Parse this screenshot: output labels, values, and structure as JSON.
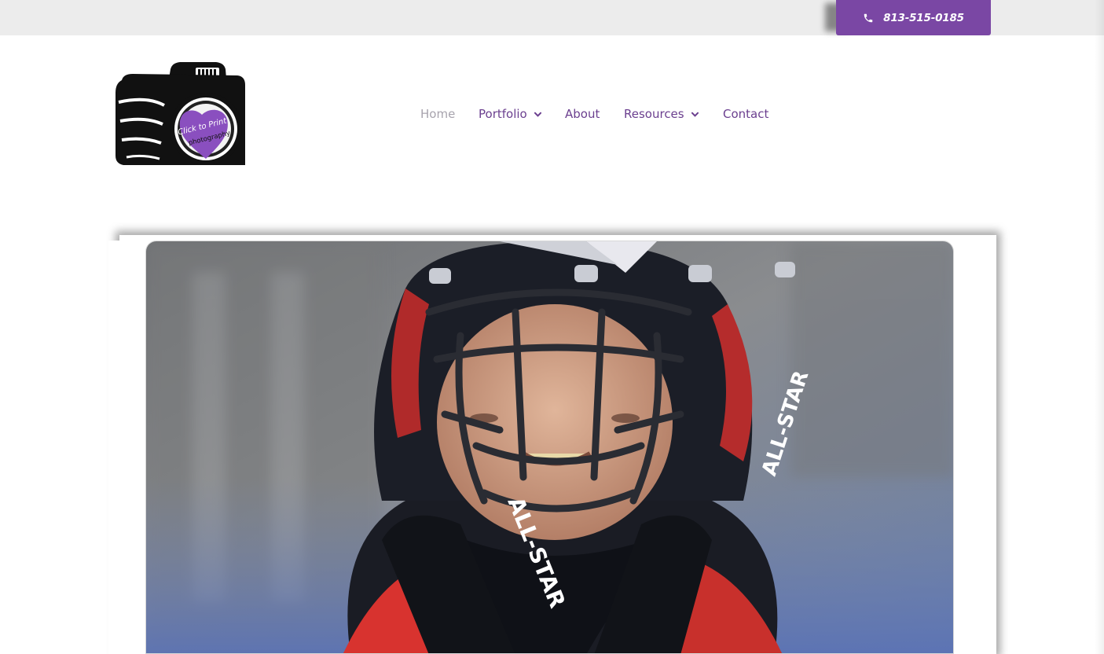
{
  "topbar": {
    "phone": {
      "icon": "phone-icon",
      "number": "813-515-0185"
    },
    "button_color": "#7a47a4"
  },
  "brand": {
    "logo_text_line1": "Click to Print",
    "logo_text_line2": "photography",
    "heart_color": "#8a4fbf"
  },
  "nav": {
    "items": [
      {
        "label": "Home",
        "active": true
      },
      {
        "label": "Portfolio",
        "has_dropdown": true
      },
      {
        "label": "About"
      },
      {
        "label": "Resources",
        "has_dropdown": true
      },
      {
        "label": "Contact"
      }
    ],
    "link_color": "#6b3f8f",
    "active_color": "#a7a3ad"
  },
  "hero": {
    "image": "baseball-catcher-photo",
    "helmet_brand_left": "ALL-STAR",
    "helmet_brand_right": "ALL-STAR"
  }
}
